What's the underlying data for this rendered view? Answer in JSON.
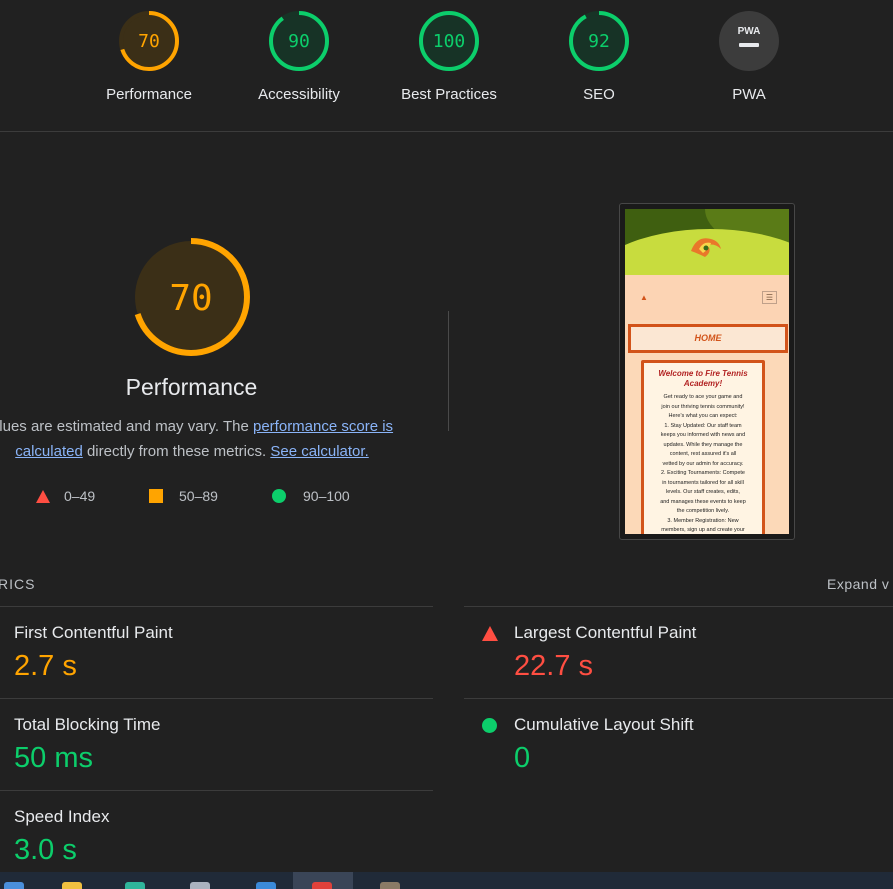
{
  "gauges": [
    {
      "score": "70",
      "label": "Performance",
      "pct": 0.7,
      "color": "#ffa400"
    },
    {
      "score": "90",
      "label": "Accessibility",
      "pct": 0.9,
      "color": "#0cce6b"
    },
    {
      "score": "100",
      "label": "Best Practices",
      "pct": 1.0,
      "color": "#0cce6b"
    },
    {
      "score": "92",
      "label": "SEO",
      "pct": 0.92,
      "color": "#0cce6b"
    },
    {
      "score": "",
      "label": "PWA",
      "badge": "PWA",
      "color": "#9aa0a6"
    }
  ],
  "performance": {
    "score": "70",
    "pct": 0.7,
    "title": "Performance",
    "desc_before": "alues are estimated and may vary. The ",
    "link1": "performance score is",
    "link1b": "calculated",
    "desc_mid": " directly from these metrics. ",
    "link2": "See calculator."
  },
  "legend": [
    {
      "range": "0–49",
      "shape": "triangle",
      "color": "#ff4e42"
    },
    {
      "range": "50–89",
      "shape": "square",
      "color": "#ffa400"
    },
    {
      "range": "90–100",
      "shape": "circle",
      "color": "#0cce6b"
    }
  ],
  "screenshot": {
    "nav_label": "HOME",
    "heading": "Welcome to Fire Tennis Academy!",
    "lines": [
      "Get ready to ace your game and",
      "join our thriving tennis community!",
      "Here's what you can expect:",
      "1. Stay Updated: Our staff team",
      "keeps you informed with news and",
      "updates. While they manage the",
      "content, rest assured it's all",
      "vetted by our admin for accuracy.",
      "2. Exciting Tournaments: Compete",
      "in tournaments tailored for all skill",
      "levels. Our staff creates, edits,",
      "and manages these events to keep",
      "the competition lively.",
      "3. Member Registration: New",
      "members, sign up and create your"
    ]
  },
  "metrics_header": {
    "left": "RICS",
    "right": "Expand v"
  },
  "metrics": [
    {
      "name": "First Contentful Paint",
      "value": "2.7 s",
      "status": "average",
      "color": "#ffa400"
    },
    {
      "name": "Largest Contentful Paint",
      "value": "22.7 s",
      "status": "fail",
      "color": "#ff4e42"
    },
    {
      "name": "Total Blocking Time",
      "value": "50 ms",
      "status": "pass",
      "color": "#0cce6b"
    },
    {
      "name": "Cumulative Layout Shift",
      "value": "0",
      "status": "pass",
      "color": "#0cce6b"
    },
    {
      "name": "Speed Index",
      "value": "3.0 s",
      "status": "pass",
      "color": "#0cce6b"
    }
  ]
}
